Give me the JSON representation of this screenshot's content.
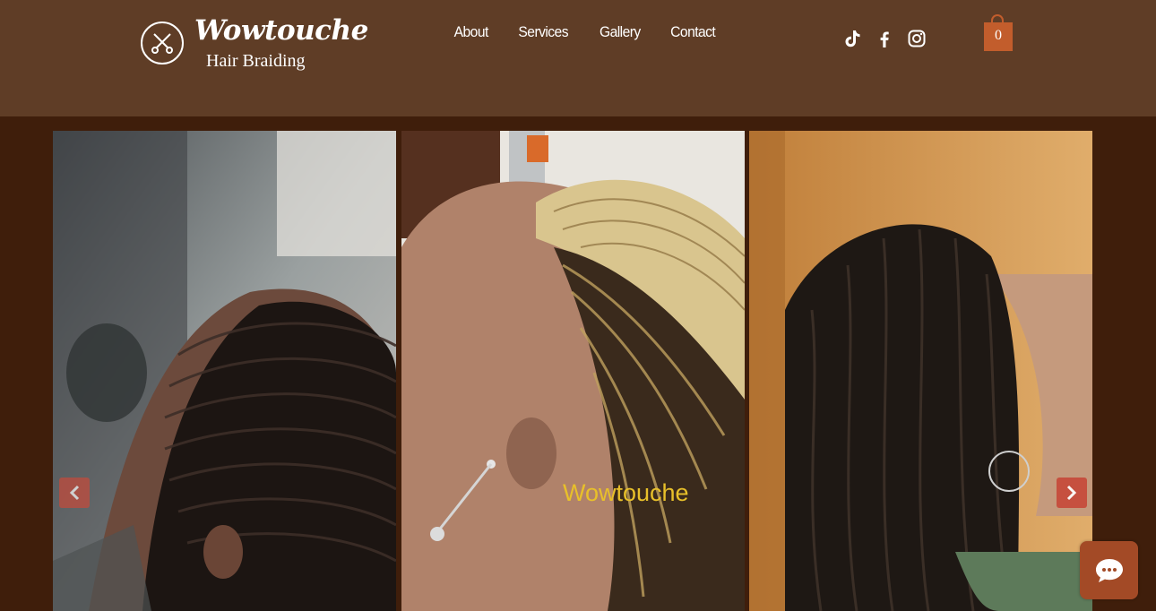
{
  "brand": {
    "name": "Wowtouche",
    "tagline": "Hair Braiding"
  },
  "nav": [
    {
      "label": "About"
    },
    {
      "label": "Services"
    },
    {
      "label": "Gallery"
    },
    {
      "label": "Contact"
    }
  ],
  "social": [
    "tiktok-icon",
    "facebook-icon",
    "instagram-icon"
  ],
  "cart": {
    "count": "0"
  },
  "gallery": {
    "caption": "Wowtouche",
    "images": [
      "cornrow-braids-side-view-photo",
      "blonde-twist-braids-photo",
      "curly-box-braids-photo"
    ]
  },
  "colors": {
    "header_bg": "#5f3d26",
    "page_bg": "#3f1e0b",
    "accent": "#c25d2c",
    "caption": "#e8c02a"
  }
}
